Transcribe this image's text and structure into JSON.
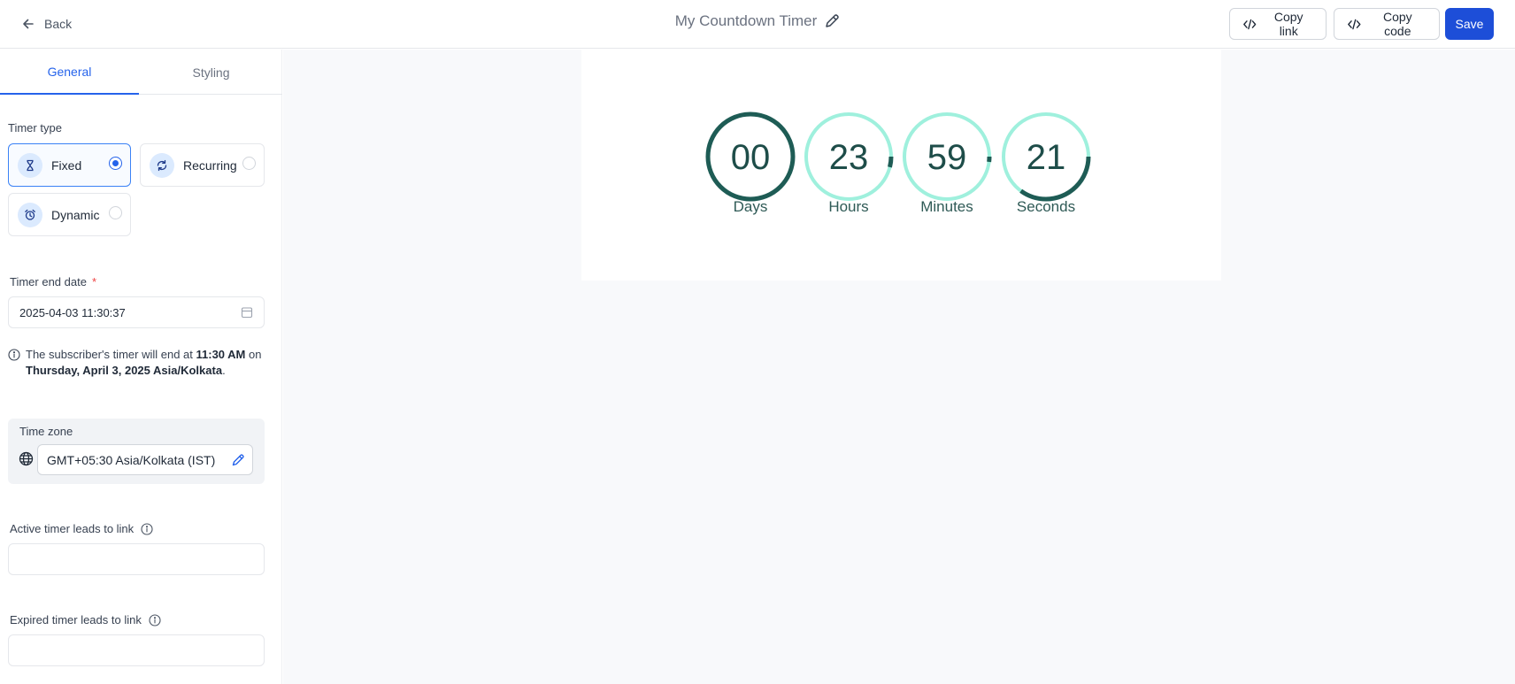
{
  "header": {
    "back_label": "Back",
    "title": "My Countdown Timer",
    "copy_link_label": "Copy link",
    "copy_code_label": "Copy code",
    "save_label": "Save"
  },
  "tabs": [
    {
      "label": "General",
      "active": true
    },
    {
      "label": "Styling",
      "active": false
    }
  ],
  "timer_type": {
    "label": "Timer type",
    "options": [
      {
        "label": "Fixed",
        "selected": true,
        "icon": "hourglass-icon"
      },
      {
        "label": "Recurring",
        "selected": false,
        "icon": "refresh-icon"
      },
      {
        "label": "Dynamic",
        "selected": false,
        "icon": "alarm-clock-icon"
      }
    ]
  },
  "end_date": {
    "label": "Timer end date",
    "required_mark": "*",
    "value": "2025-04-03 11:30:37"
  },
  "info": {
    "prefix": "The subscriber's timer will end at ",
    "time": "11:30 AM",
    "middle": " on ",
    "date": "Thursday, April 3, 2025 Asia/Kolkata",
    "suffix": "."
  },
  "timezone": {
    "label": "Time zone",
    "value": "GMT+05:30 Asia/Kolkata (IST)"
  },
  "active_link": {
    "label": "Active timer leads to link",
    "value": ""
  },
  "expired_link": {
    "label": "Expired timer leads to link",
    "value": ""
  },
  "countdown": {
    "units": [
      {
        "value": "00",
        "label": "Days",
        "progress": 1.0
      },
      {
        "value": "23",
        "label": "Hours",
        "progress": 0.04
      },
      {
        "value": "59",
        "label": "Minutes",
        "progress": 0.02
      },
      {
        "value": "21",
        "label": "Seconds",
        "progress": 0.35
      }
    ],
    "colors": {
      "track": "#9ff0dd",
      "progress": "#1e5c55",
      "text": "#1e4d49"
    }
  }
}
